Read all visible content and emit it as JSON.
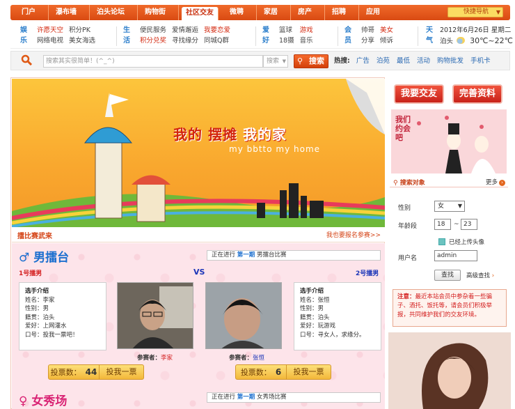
{
  "nav": {
    "items": [
      "门户",
      "瀑布墙",
      "泊头论坛",
      "购物街",
      "社区交友",
      "微聘",
      "家居",
      "房产",
      "招聘",
      "应用"
    ],
    "active_index": 4,
    "shortcut": "快捷导航"
  },
  "links": {
    "groups": [
      {
        "label": "娱乐",
        "items": [
          "许愿天空",
          "积分PK",
          "网络电视",
          "美女海选"
        ],
        "red": [
          0
        ]
      },
      {
        "label": "生活",
        "items": [
          "便民服务",
          "爱情邂逅",
          "我要恋爱",
          "积分兑奖",
          "寻找缘分",
          "同城Q群"
        ],
        "red": [
          2,
          3
        ]
      },
      {
        "label": "爱好",
        "items": [
          "篮球",
          "游戏",
          "18摄",
          "音乐"
        ],
        "red": [
          1
        ]
      },
      {
        "label": "会员",
        "items": [
          "帅哥",
          "美女",
          "分享",
          "倾诉"
        ],
        "red": [
          1
        ]
      }
    ],
    "weather": {
      "label": "天气",
      "date": "2012年6月26日 星期二",
      "city": "泊头",
      "temp": "30℃~22℃"
    }
  },
  "search": {
    "placeholder": "搜索其实很简单！(^_^)",
    "scope": "搜索",
    "button": "搜索",
    "hot_label": "热搜:",
    "hot": [
      "广告",
      "泊苑",
      "最低",
      "活动",
      "购物批发",
      "手机卡"
    ]
  },
  "banner": {
    "title_1": "我的 摆摊",
    "title_2": "我的家",
    "subtitle": "my  bbtto  my  home"
  },
  "section": {
    "left": "擂比赛武来",
    "right": "我也要报名参赛>>"
  },
  "arena": {
    "male_title": "男擂台",
    "status_prefix": "正在进行",
    "status_round": "第一期",
    "male_status_suffix": "男擂台比赛",
    "female_title": "女秀场",
    "female_status_suffix": "女秀场比赛",
    "player1_label": "1号擂男",
    "vs": "VS",
    "player2_label": "2号擂男",
    "player1": {
      "intro_title": "选手介绍",
      "name": "姓名：李家",
      "gender": "性别：男",
      "hometown": "籍贯：泊头",
      "hobby": "爱好：上网灌水",
      "slogan": "口号：投我一票吧！",
      "entrant_label": "参赛者：",
      "entrant": "李家",
      "votes_label": "投票数：",
      "votes": 44,
      "vote_button": "投我一票"
    },
    "player2": {
      "intro_title": "选手介绍",
      "name": "姓名：张恒",
      "gender": "性别：男",
      "hometown": "籍贯：泊头",
      "hobby": "爱好：玩游戏",
      "slogan": "口号：寻女人，求缘分。",
      "entrant_label": "参赛者：",
      "entrant": "张恒",
      "votes_label": "投票数：",
      "votes": 6,
      "vote_button": "投我一票"
    }
  },
  "side": {
    "btn_make_friends": "我要交友",
    "btn_profile": "完善资料",
    "poster_text": "我们约会吧",
    "search_title": "搜索对象",
    "more": "更多",
    "gender_label": "性别",
    "gender_value": "女",
    "age_label": "年龄段",
    "age_from": "18",
    "age_sep": "~",
    "age_to": "23",
    "photo_label": "已经上传头像",
    "user_label": "用户名",
    "user_value": "admin",
    "search_button": "查找",
    "advanced": "高级查找",
    "notice_label": "注意：",
    "notice_text": "最近本站会员中参杂着一些骗子、酒托、饭托等，请会员们积极举报，共同维护我们的交友环境。"
  }
}
